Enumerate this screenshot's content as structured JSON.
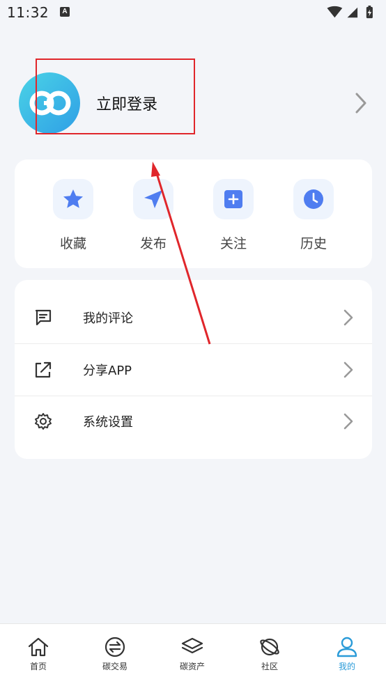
{
  "status_bar": {
    "time": "11:32",
    "notification_glyph": "A"
  },
  "profile": {
    "login_label": "立即登录"
  },
  "quick_actions": [
    {
      "label": "收藏",
      "icon": "star-icon"
    },
    {
      "label": "发布",
      "icon": "send-icon"
    },
    {
      "label": "关注",
      "icon": "plus-square-icon"
    },
    {
      "label": "历史",
      "icon": "clock-icon"
    }
  ],
  "menu": [
    {
      "label": "我的评论",
      "icon": "comment-icon"
    },
    {
      "label": "分享APP",
      "icon": "share-icon"
    },
    {
      "label": "系统设置",
      "icon": "settings-icon"
    }
  ],
  "tabs": [
    {
      "label": "首页",
      "icon": "home-icon",
      "active": false
    },
    {
      "label": "碳交易",
      "icon": "exchange-icon",
      "active": false
    },
    {
      "label": "碳资产",
      "icon": "layers-icon",
      "active": false
    },
    {
      "label": "社区",
      "icon": "planet-icon",
      "active": false
    },
    {
      "label": "我的",
      "icon": "user-icon",
      "active": true
    }
  ],
  "colors": {
    "accent": "#4f7df0",
    "active_tab": "#2a9bd8",
    "annotation": "#e0262b",
    "background": "#f3f5f9"
  }
}
